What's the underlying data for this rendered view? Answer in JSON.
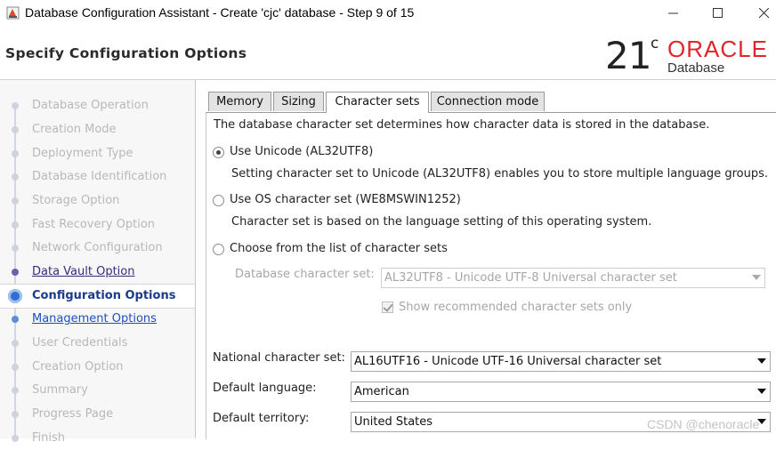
{
  "window": {
    "title": "Database Configuration Assistant - Create 'cjc' database - Step 9 of 15",
    "controls": [
      "minimize",
      "maximize",
      "close"
    ]
  },
  "header": {
    "title": "Specify Configuration Options",
    "logo": {
      "version": "21",
      "superscript": "c",
      "brand": "ORACLE",
      "product": "Database",
      "brand_color": "#e0262b"
    }
  },
  "nav": {
    "items": [
      {
        "label": "Database Operation",
        "state": "done"
      },
      {
        "label": "Creation Mode",
        "state": "done"
      },
      {
        "label": "Deployment Type",
        "state": "done"
      },
      {
        "label": "Database Identification",
        "state": "done"
      },
      {
        "label": "Storage Option",
        "state": "done"
      },
      {
        "label": "Fast Recovery Option",
        "state": "done"
      },
      {
        "label": "Network Configuration",
        "state": "done"
      },
      {
        "label": "Data Vault Option",
        "state": "link"
      },
      {
        "label": "Configuration Options",
        "state": "current"
      },
      {
        "label": "Management Options",
        "state": "link"
      },
      {
        "label": "User Credentials",
        "state": "pending"
      },
      {
        "label": "Creation Option",
        "state": "pending"
      },
      {
        "label": "Summary",
        "state": "pending"
      },
      {
        "label": "Progress Page",
        "state": "pending"
      },
      {
        "label": "Finish",
        "state": "pending"
      }
    ]
  },
  "tabs": [
    {
      "label": "Memory",
      "active": false
    },
    {
      "label": "Sizing",
      "active": false
    },
    {
      "label": "Character sets",
      "active": true
    },
    {
      "label": "Connection mode",
      "active": false
    }
  ],
  "charset": {
    "intro": "The database character set determines how character data is stored in the database.",
    "options": [
      {
        "label": "Use Unicode (AL32UTF8)",
        "description": "Setting character set to Unicode (AL32UTF8) enables you to store multiple language groups.",
        "selected": true
      },
      {
        "label": "Use OS character set (WE8MSWIN1252)",
        "description": "Character set is based on the language setting of this operating system.",
        "selected": false
      },
      {
        "label": "Choose from the list of character sets",
        "description": "",
        "selected": false
      }
    ],
    "db_charset_label": "Database character set:",
    "db_charset_value": "AL32UTF8 - Unicode UTF-8 Universal character set",
    "show_recommended_label": "Show recommended character sets only",
    "show_recommended_checked": true
  },
  "fields": {
    "national_label": "National character set:",
    "national_value": "AL16UTF16 - Unicode UTF-16 Universal character set",
    "language_label": "Default language:",
    "language_value": "American",
    "territory_label": "Default territory:",
    "territory_value": "United States"
  },
  "watermark": "CSDN @chenoracle"
}
